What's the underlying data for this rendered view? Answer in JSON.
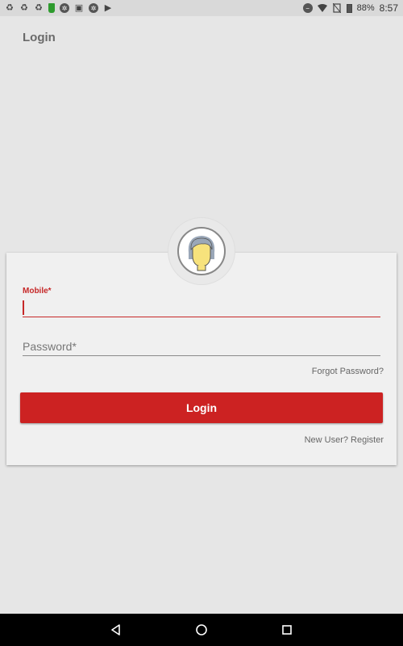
{
  "status_bar": {
    "battery": "88%",
    "time": "8:57",
    "left_icons": [
      "recycle-icon",
      "recycle-icon",
      "recycle-icon",
      "green-bucket-icon",
      "settings-app-icon",
      "gallery-icon",
      "settings-app-icon",
      "store-icon"
    ],
    "right_icons": [
      "dnd-icon",
      "wifi-icon",
      "no-sim-icon",
      "battery-icon"
    ]
  },
  "header": {
    "title": "Login"
  },
  "form": {
    "mobile_label": "Mobile*",
    "mobile_value": "",
    "password_placeholder": "Password*",
    "forgot_password": "Forgot Password?",
    "login_button": "Login",
    "register_link": "New User? Register"
  },
  "colors": {
    "accent": "#cc2222",
    "background": "#e6e6e6",
    "card": "#f0f0f0"
  },
  "nav_bar": {
    "icons": [
      "back-icon",
      "home-icon",
      "recents-icon"
    ]
  }
}
